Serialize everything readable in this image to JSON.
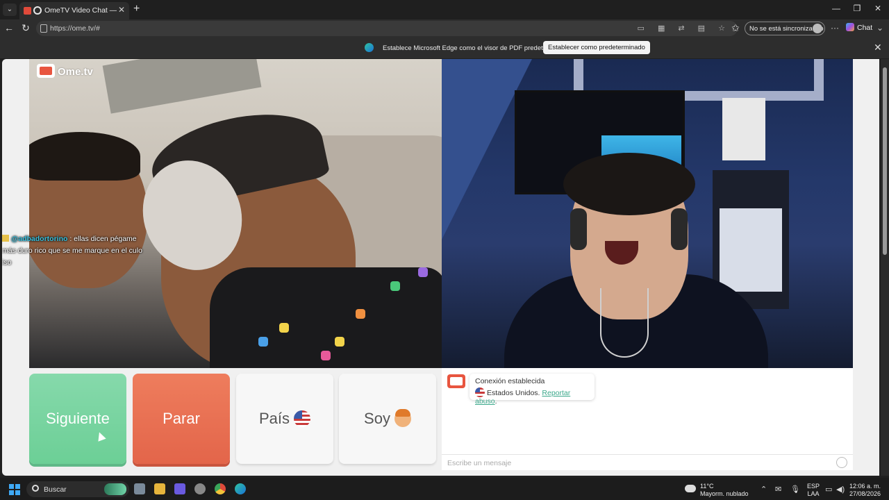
{
  "browser": {
    "tab_title": "OmeTV Video Chat — Omegl",
    "url": "https://ome.tv/#",
    "sync_label": "No se está sincronizando",
    "chat_label": "Chat",
    "infobar_message": "Establece Microsoft Edge como el visor de PDF predeterminado",
    "infobar_button": "Establecer como predeterminado"
  },
  "page": {
    "logo_text": "Ome.tv",
    "overlay_chat": {
      "user": "@adbadortorino",
      "text": " : ellas dicen pégame más duro rico que se me marque en el culo iso"
    },
    "buttons": {
      "next": "Siguiente",
      "stop": "Parar",
      "country": "País",
      "soy": "Soy"
    },
    "chat": {
      "status": "Conexión establecida",
      "country": "Estados Unidos.",
      "report": "Reportar abuso",
      "report_suffix": ".",
      "input_placeholder": "Escribe un mensaje"
    }
  },
  "taskbar": {
    "search_label": "Buscar",
    "weather_temp": "11°C",
    "weather_desc": "Mayorm. nublado",
    "lang_top": "ESP",
    "lang_bottom": "LAA",
    "time": "12:06 a. m.",
    "date": "27/08/2026"
  },
  "colors": {
    "next": "#6ccf96",
    "stop": "#e3654a",
    "link": "#3aa88a"
  }
}
